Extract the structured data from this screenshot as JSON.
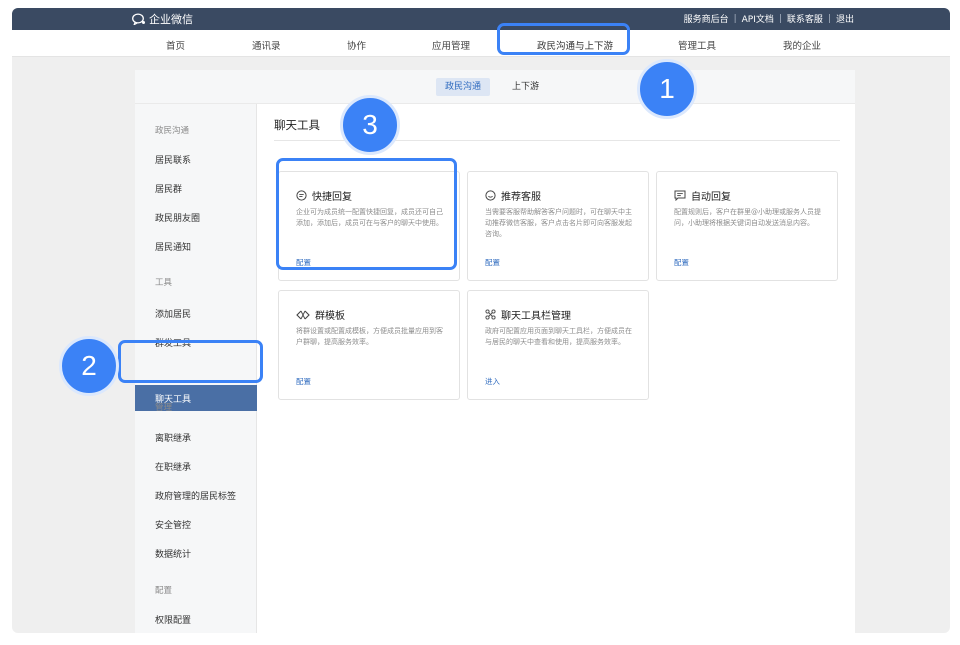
{
  "topbar": {
    "logo_text": "企业微信",
    "links": [
      "服务商后台",
      "API文档",
      "联系客服",
      "退出"
    ],
    "separator": "|"
  },
  "nav": {
    "items": [
      "首页",
      "通讯录",
      "协作",
      "应用管理",
      "政民沟通与上下游",
      "管理工具",
      "我的企业"
    ],
    "active_index": 4
  },
  "subtabs": {
    "items": [
      "政民沟通",
      "上下游"
    ],
    "active_index": 0
  },
  "sidebar": {
    "groups": [
      {
        "label": "政民沟通",
        "items": [
          "居民联系",
          "居民群",
          "政民朋友圈",
          "居民通知"
        ]
      },
      {
        "label": "工具",
        "items": [
          "添加居民",
          "群发工具",
          "聊天工具"
        ]
      },
      {
        "label": "管理",
        "items": [
          "离职继承",
          "在职继承",
          "政府管理的居民标签",
          "安全管控",
          "数据统计"
        ]
      },
      {
        "label": "配置",
        "items": [
          "权限配置"
        ]
      }
    ],
    "active_item": "聊天工具"
  },
  "main": {
    "title": "聊天工具",
    "cards": [
      {
        "icon": "quick-reply-icon",
        "title": "快捷回复",
        "desc": "企业可为成员统一配置快捷回复，成员还可自己添加，添加后，成员可在与客户的聊天中使用。",
        "link": "配置"
      },
      {
        "icon": "recommend-service-icon",
        "title": "推荐客服",
        "desc": "当需要客服帮助解答客户问题时，可在聊天中主动推荐微信客服，客户点击名片即可向客服发起咨询。",
        "link": "配置"
      },
      {
        "icon": "auto-reply-icon",
        "title": "自动回复",
        "desc": "配置规则后，客户在群里@小助理或服务人员提问，小助理将根据关键词自动发送消息内容。",
        "link": "配置"
      },
      {
        "icon": "group-template-icon",
        "title": "群模板",
        "desc": "将群设置或配置成模板，方便成员批量应用到客户群聊，提高服务效率。",
        "link": "配置"
      },
      {
        "icon": "toolbar-manage-icon",
        "title": "聊天工具栏管理",
        "desc": "政府可配置应用页面到聊天工具栏，方便成员在与居民的聊天中查看和使用，提高服务效率。",
        "link": "进入"
      }
    ]
  },
  "annotations": {
    "labels": [
      "1",
      "2",
      "3"
    ],
    "color": "#3b82f6"
  },
  "colors": {
    "topbar": "#3a4a62",
    "active_sidebar": "#4a6fa5",
    "link": "#2f6bbf"
  }
}
